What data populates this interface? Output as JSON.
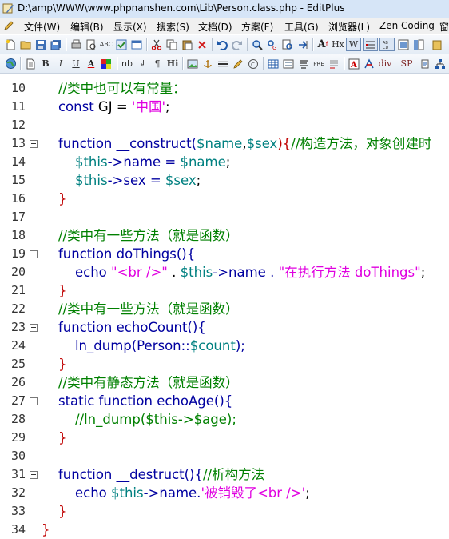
{
  "window": {
    "title": "D:\\amp\\WWW\\www.phpnanshen.com\\Lib\\Person.class.php - EditPlus"
  },
  "menu": [
    {
      "label": "文件(W)"
    },
    {
      "label": "编辑(B)"
    },
    {
      "label": "显示(X)"
    },
    {
      "label": "搜索(S)"
    },
    {
      "label": "文档(D)"
    },
    {
      "label": "方案(F)"
    },
    {
      "label": "工具(G)"
    },
    {
      "label": "浏览器(L)"
    },
    {
      "label": "Zen Coding"
    },
    {
      "label": "窗"
    }
  ],
  "toolbar2_text_buttons": {
    "bold": "B",
    "italic": "I",
    "underline": "U",
    "font_color": "A",
    "nb": "nb",
    "br": "↲",
    "para": "¶",
    "heading": "Hi",
    "pre": "PRE",
    "div": "div",
    "sp": "SP"
  },
  "toolbar1_text_buttons": {
    "hx": "Hx",
    "w": "W"
  },
  "colors": {
    "keyword": "#0000a0",
    "comment": "#008000",
    "string": "#e000e0",
    "variable": "#008080",
    "plain": "#000000"
  },
  "lines": [
    {
      "num": "10",
      "fold": false,
      "tokens": [
        {
          "t": "    ",
          "c": "p"
        },
        {
          "t": "//类中也可以有常量：",
          "c": "c"
        }
      ]
    },
    {
      "num": "11",
      "fold": false,
      "tokens": [
        {
          "t": "    ",
          "c": "p"
        },
        {
          "t": "const",
          "c": "k"
        },
        {
          "t": " GJ = ",
          "c": "p"
        },
        {
          "t": "'中国'",
          "c": "s"
        },
        {
          "t": ";",
          "c": "p"
        }
      ]
    },
    {
      "num": "12",
      "fold": false,
      "tokens": []
    },
    {
      "num": "13",
      "fold": true,
      "tokens": [
        {
          "t": "    ",
          "c": "p"
        },
        {
          "t": "function",
          "c": "k"
        },
        {
          "t": " __construct(",
          "c": "k"
        },
        {
          "t": "$name",
          "c": "v"
        },
        {
          "t": ",",
          "c": "p"
        },
        {
          "t": "$sex",
          "c": "v"
        },
        {
          "t": "){",
          "c": "red"
        },
        {
          "t": "//构造方法，对象创建时",
          "c": "c"
        }
      ]
    },
    {
      "num": "14",
      "fold": false,
      "tokens": [
        {
          "t": "        ",
          "c": "p"
        },
        {
          "t": "$this",
          "c": "v"
        },
        {
          "t": "->name = ",
          "c": "k"
        },
        {
          "t": "$name",
          "c": "v"
        },
        {
          "t": ";",
          "c": "p"
        }
      ]
    },
    {
      "num": "15",
      "fold": false,
      "tokens": [
        {
          "t": "        ",
          "c": "p"
        },
        {
          "t": "$this",
          "c": "v"
        },
        {
          "t": "->sex = ",
          "c": "k"
        },
        {
          "t": "$sex",
          "c": "v"
        },
        {
          "t": ";",
          "c": "p"
        }
      ]
    },
    {
      "num": "16",
      "fold": false,
      "tokens": [
        {
          "t": "    ",
          "c": "p"
        },
        {
          "t": "}",
          "c": "red"
        }
      ]
    },
    {
      "num": "17",
      "fold": false,
      "tokens": []
    },
    {
      "num": "18",
      "fold": false,
      "tokens": [
        {
          "t": "    ",
          "c": "p"
        },
        {
          "t": "//类中有一些方法（就是函数）",
          "c": "c"
        }
      ]
    },
    {
      "num": "19",
      "fold": true,
      "tokens": [
        {
          "t": "    ",
          "c": "p"
        },
        {
          "t": "function",
          "c": "k"
        },
        {
          "t": " doThings(){",
          "c": "k"
        }
      ]
    },
    {
      "num": "20",
      "fold": false,
      "tokens": [
        {
          "t": "        ",
          "c": "p"
        },
        {
          "t": "echo",
          "c": "k"
        },
        {
          "t": " ",
          "c": "p"
        },
        {
          "t": "\"<br />\"",
          "c": "s"
        },
        {
          "t": " . ",
          "c": "p"
        },
        {
          "t": "$this",
          "c": "v"
        },
        {
          "t": "->name . ",
          "c": "k"
        },
        {
          "t": "\"在执行方法 doThings\"",
          "c": "s"
        },
        {
          "t": ";",
          "c": "p"
        }
      ]
    },
    {
      "num": "21",
      "fold": false,
      "tokens": [
        {
          "t": "    ",
          "c": "p"
        },
        {
          "t": "}",
          "c": "red"
        }
      ]
    },
    {
      "num": "22",
      "fold": false,
      "tokens": [
        {
          "t": "    ",
          "c": "p"
        },
        {
          "t": "//类中有一些方法（就是函数）",
          "c": "c"
        }
      ]
    },
    {
      "num": "23",
      "fold": true,
      "tokens": [
        {
          "t": "    ",
          "c": "p"
        },
        {
          "t": "function",
          "c": "k"
        },
        {
          "t": " echoCount(){",
          "c": "k"
        }
      ]
    },
    {
      "num": "24",
      "fold": false,
      "tokens": [
        {
          "t": "        ",
          "c": "p"
        },
        {
          "t": "ln_dump(Person::",
          "c": "k"
        },
        {
          "t": "$count",
          "c": "v"
        },
        {
          "t": ");",
          "c": "k"
        }
      ]
    },
    {
      "num": "25",
      "fold": false,
      "tokens": [
        {
          "t": "    ",
          "c": "p"
        },
        {
          "t": "}",
          "c": "red"
        }
      ]
    },
    {
      "num": "26",
      "fold": false,
      "tokens": [
        {
          "t": "    ",
          "c": "p"
        },
        {
          "t": "//类中有静态方法（就是函数）",
          "c": "c"
        }
      ]
    },
    {
      "num": "27",
      "fold": true,
      "tokens": [
        {
          "t": "    ",
          "c": "p"
        },
        {
          "t": "static",
          "c": "k"
        },
        {
          "t": " ",
          "c": "p"
        },
        {
          "t": "function",
          "c": "k"
        },
        {
          "t": " echoAge(){",
          "c": "k"
        }
      ]
    },
    {
      "num": "28",
      "fold": false,
      "tokens": [
        {
          "t": "        ",
          "c": "p"
        },
        {
          "t": "//ln_dump($this->$age);",
          "c": "c"
        }
      ]
    },
    {
      "num": "29",
      "fold": false,
      "tokens": [
        {
          "t": "    ",
          "c": "p"
        },
        {
          "t": "}",
          "c": "red"
        }
      ]
    },
    {
      "num": "30",
      "fold": false,
      "tokens": []
    },
    {
      "num": "31",
      "fold": true,
      "tokens": [
        {
          "t": "    ",
          "c": "p"
        },
        {
          "t": "function",
          "c": "k"
        },
        {
          "t": " __destruct(){",
          "c": "k"
        },
        {
          "t": "//析构方法",
          "c": "c"
        }
      ]
    },
    {
      "num": "32",
      "fold": false,
      "tokens": [
        {
          "t": "        ",
          "c": "p"
        },
        {
          "t": "echo",
          "c": "k"
        },
        {
          "t": " ",
          "c": "p"
        },
        {
          "t": "$this",
          "c": "v"
        },
        {
          "t": "->name.",
          "c": "k"
        },
        {
          "t": "'被销毁了<br />'",
          "c": "s"
        },
        {
          "t": ";",
          "c": "p"
        }
      ]
    },
    {
      "num": "33",
      "fold": false,
      "tokens": [
        {
          "t": "    ",
          "c": "p"
        },
        {
          "t": "}",
          "c": "red"
        }
      ]
    },
    {
      "num": "34",
      "fold": false,
      "tokens": [
        {
          "t": "}",
          "c": "red"
        }
      ]
    }
  ]
}
